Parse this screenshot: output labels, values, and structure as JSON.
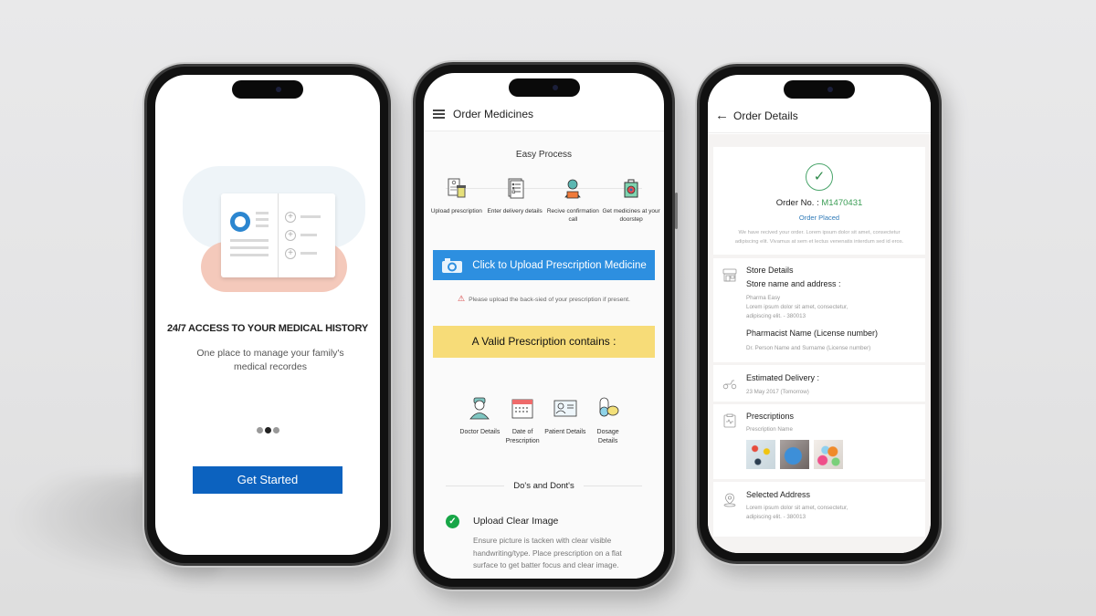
{
  "onboarding": {
    "title": "24/7 ACCESS TO YOUR MEDICAL HISTORY",
    "subtitle": "One place to manage your family's medical recordes",
    "pager": {
      "count": 3,
      "active_index": 1
    },
    "cta_label": "Get Started",
    "accent_color": "#0c62bf"
  },
  "order_medicines": {
    "header_title": "Order Medicines",
    "menu_icon": "hamburger-menu-icon",
    "easy_process_title": "Easy Process",
    "steps": [
      {
        "icon": "prescription-upload-icon",
        "label": "Upload prescription"
      },
      {
        "icon": "delivery-checklist-icon",
        "label": "Enter delivery details"
      },
      {
        "icon": "call-support-agent-icon",
        "label": "Recive confirmation call"
      },
      {
        "icon": "medicine-bag-icon",
        "label": "Get medicines at your doorstep"
      }
    ],
    "upload_button_label": "Click to Upload Prescription Medicine",
    "upload_icon": "camera-icon",
    "warning_text": "Please upload the back-sied of your prescription if present.",
    "valid_prescription_title": "A Valid Prescription contains :",
    "prescription_items": [
      {
        "icon": "doctor-icon",
        "label": "Doctor Details"
      },
      {
        "icon": "calendar-icon",
        "label": "Date of Prescription"
      },
      {
        "icon": "patient-id-card-icon",
        "label": "Patient Details"
      },
      {
        "icon": "pills-icon",
        "label": "Dosage Details"
      }
    ],
    "dos_donts_title": "Do's and Dont's",
    "tip": {
      "title": "Upload Clear Image",
      "description": "Ensure picture is tacken with clear visible handwriting/type. Place prescription on a flat surface to get batter focus and clear image."
    },
    "upload_color": "#2d8fe0",
    "valid_color": "#f7dc78"
  },
  "order_details": {
    "header_title": "Order Details",
    "back_icon": "arrow-left-icon",
    "order_no_label": "Order No. :",
    "order_no_value": "M1470431",
    "status": "Order Placed",
    "message": "We have recived your order. Lorem ipsum dolor sit amet, consectetur adipiscing elit. Vivamus at sem et lectus venenatis interdum sed id eros.",
    "store": {
      "title": "Store Details",
      "subtitle": "Store name and address :",
      "name": "Pharma Easy",
      "address_line1": "Lorem ipsum dolor sit amet, consectetur,",
      "address_line2": "adipiscing elit. - 380013",
      "pharmacist_title": "Pharmacist Name (License number)",
      "pharmacist_value": "Dr. Person Name and Surname (License number)"
    },
    "delivery": {
      "title": "Estimated Delivery :",
      "value": "23 May 2017 (Tomorrow)"
    },
    "prescriptions": {
      "title": "Prescriptions",
      "subtitle": "Prescription Name",
      "thumbnails": [
        "prescription-thumbnail-1",
        "prescription-thumbnail-2",
        "prescription-thumbnail-3"
      ]
    },
    "address": {
      "title": "Selected Address",
      "line1": "Lorem ipsum dolor sit amet, consectetur,",
      "line2": "adipiscing elit. - 380013"
    },
    "success_color": "#3b9d55",
    "status_color": "#2f7ab8"
  }
}
